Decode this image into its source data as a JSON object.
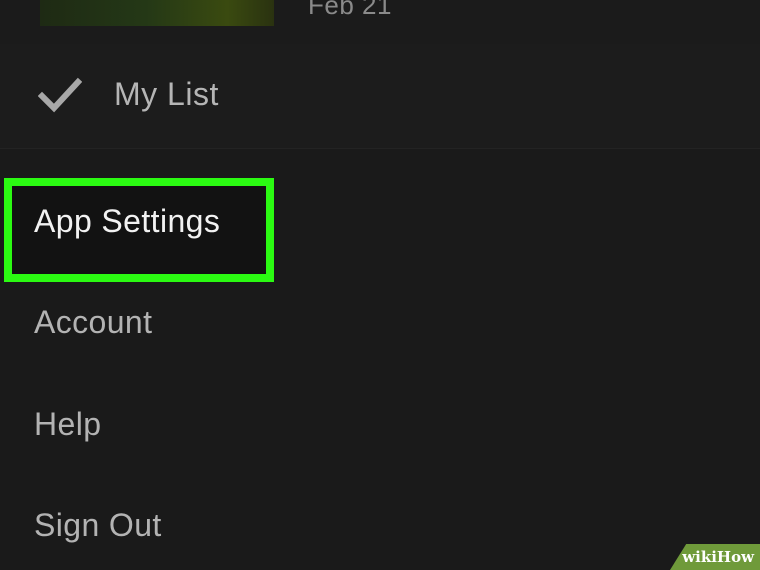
{
  "top_item": {
    "date": "Feb 21"
  },
  "my_list": {
    "label": "My List",
    "icon": "check-icon"
  },
  "menu": {
    "items": [
      {
        "label": "App Settings",
        "highlighted": true
      },
      {
        "label": "Account"
      },
      {
        "label": "Help"
      },
      {
        "label": "Sign Out"
      }
    ]
  },
  "highlight_color": "#2bfa12",
  "watermark": {
    "wiki": "wiki",
    "how": "How"
  }
}
